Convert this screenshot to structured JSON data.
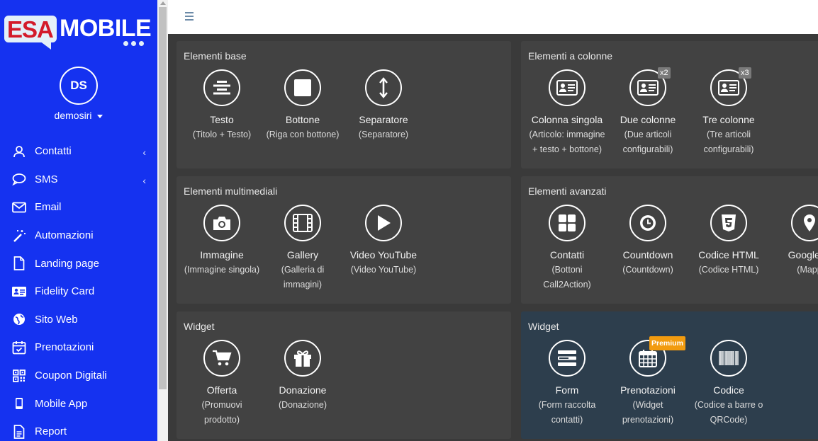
{
  "brand": {
    "part1": "ESA",
    "part2": "MOBILE"
  },
  "user": {
    "initials": "DS",
    "name": "demosiri"
  },
  "colors": {
    "sidebar": "#1532f0",
    "panel": "#424242",
    "panel_highlight": "#2d3e4d",
    "premium": "#f29b0f",
    "logo_red": "#d31a2a"
  },
  "nav": [
    {
      "label": "Contatti",
      "icon": "user-icon",
      "chevron": "‹"
    },
    {
      "label": "SMS",
      "icon": "chat-bubble-icon",
      "chevron": "‹"
    },
    {
      "label": "Email",
      "icon": "envelope-icon"
    },
    {
      "label": "Automazioni",
      "icon": "magic-wand-icon"
    },
    {
      "label": "Landing page",
      "icon": "file-icon"
    },
    {
      "label": "Fidelity Card",
      "icon": "id-card-icon"
    },
    {
      "label": "Sito Web",
      "icon": "globe-icon"
    },
    {
      "label": "Prenotazioni",
      "icon": "calendar-check-icon"
    },
    {
      "label": "Coupon Digitali",
      "icon": "qrcode-icon"
    },
    {
      "label": "Mobile App",
      "icon": "mobile-icon"
    },
    {
      "label": "Report",
      "icon": "report-icon"
    }
  ],
  "panels": {
    "base": {
      "title": "Elementi base",
      "items": [
        {
          "name": "Testo",
          "desc": "(Titolo + Testo)",
          "icon": "align-center-icon"
        },
        {
          "name": "Bottone",
          "desc": "(Riga con bottone)",
          "icon": "square-icon"
        },
        {
          "name": "Separatore",
          "desc": "(Separatore)",
          "icon": "arrows-vertical-icon"
        }
      ]
    },
    "colonne": {
      "title": "Elementi a colonne",
      "items": [
        {
          "name": "Colonna singola",
          "desc": "(Articolo: immagine + testo + bottone)",
          "icon": "id-card-icon"
        },
        {
          "name": "Due colonne",
          "desc": "(Due articoli configurabili)",
          "icon": "id-card-icon",
          "badge": "x2"
        },
        {
          "name": "Tre colonne",
          "desc": "(Tre articoli configurabili)",
          "icon": "id-card-icon",
          "badge": "x3"
        }
      ]
    },
    "multimedia": {
      "title": "Elementi multimediali",
      "items": [
        {
          "name": "Immagine",
          "desc": "(Immagine singola)",
          "icon": "camera-icon"
        },
        {
          "name": "Gallery",
          "desc": "(Galleria di immagini)",
          "icon": "film-icon"
        },
        {
          "name": "Video YouTube",
          "desc": "(Video YouTube)",
          "icon": "play-icon"
        }
      ]
    },
    "avanzati": {
      "title": "Elementi avanzati",
      "items": [
        {
          "name": "Contatti",
          "desc": "(Bottoni Call2Action)",
          "icon": "grid-icon"
        },
        {
          "name": "Countdown",
          "desc": "(Countdown)",
          "icon": "clock-icon"
        },
        {
          "name": "Codice HTML",
          "desc": "(Codice HTML)",
          "icon": "html5-icon"
        },
        {
          "name": "Google m",
          "desc": "(Mapp",
          "icon": "map-marker-icon"
        }
      ]
    },
    "widget1": {
      "title": "Widget",
      "items": [
        {
          "name": "Offerta",
          "desc": "(Promuovi prodotto)",
          "icon": "cart-icon"
        },
        {
          "name": "Donazione",
          "desc": "(Donazione)",
          "icon": "gift-icon"
        }
      ]
    },
    "widget2": {
      "title": "Widget",
      "items": [
        {
          "name": "Form",
          "desc": "(Form raccolta contatti)",
          "icon": "form-icon"
        },
        {
          "name": "Prenotazioni",
          "desc": "(Widget prenotazioni)",
          "icon": "calendar-icon",
          "premium": "Premium"
        },
        {
          "name": "Codice",
          "desc": "(Codice a barre o QRCode)",
          "icon": "barcode-icon"
        }
      ]
    }
  }
}
